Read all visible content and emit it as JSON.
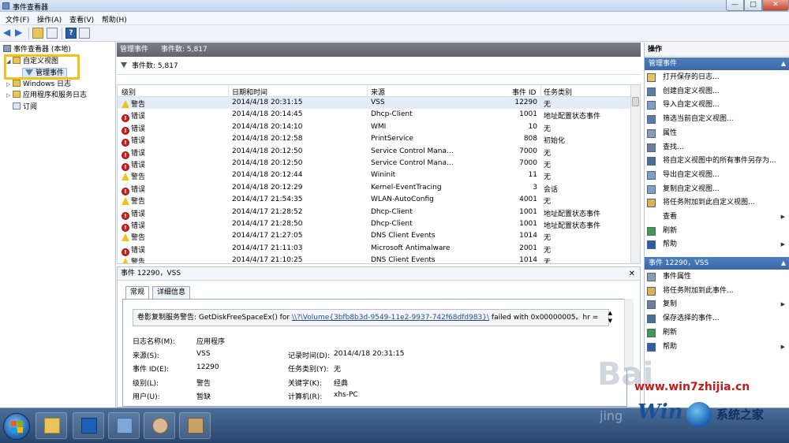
{
  "window": {
    "title": "事件查看器",
    "min_label": "—",
    "max_label": "□",
    "close_label": "✕"
  },
  "menu": [
    "文件(F)",
    "操作(A)",
    "查看(V)",
    "帮助(H)"
  ],
  "tree": {
    "root": "事件查看器 (本地)",
    "custom_views": "自定义视图",
    "admin_events": "管理事件",
    "windows_logs": "Windows 日志",
    "app_service_logs": "应用程序和服务日志",
    "subscriptions": "订阅"
  },
  "center": {
    "header_title": "管理事件",
    "header_count": "事件数: 5,817",
    "filter_text": "事件数: 5,817",
    "columns": [
      "级别",
      "日期和时间",
      "来源",
      "事件 ID",
      "任务类别"
    ],
    "rows": [
      {
        "level": "警告",
        "type": "warn",
        "datetime": "2014/4/18 20:31:15",
        "source": "VSS",
        "id": "12290",
        "category": "无"
      },
      {
        "level": "错误",
        "type": "err",
        "datetime": "2014/4/18 20:14:45",
        "source": "Dhcp-Client",
        "id": "1001",
        "category": "地址配置状态事件"
      },
      {
        "level": "错误",
        "type": "err",
        "datetime": "2014/4/18 20:14:10",
        "source": "WMI",
        "id": "10",
        "category": "无"
      },
      {
        "level": "错误",
        "type": "err",
        "datetime": "2014/4/18 20:12:58",
        "source": "PrintService",
        "id": "808",
        "category": "初始化"
      },
      {
        "level": "错误",
        "type": "err",
        "datetime": "2014/4/18 20:12:50",
        "source": "Service Control Mana...",
        "id": "7000",
        "category": "无"
      },
      {
        "level": "错误",
        "type": "err",
        "datetime": "2014/4/18 20:12:50",
        "source": "Service Control Mana...",
        "id": "7000",
        "category": "无"
      },
      {
        "level": "警告",
        "type": "warn",
        "datetime": "2014/4/18 20:12:44",
        "source": "Wininit",
        "id": "11",
        "category": "无"
      },
      {
        "level": "错误",
        "type": "err",
        "datetime": "2014/4/18 20:12:29",
        "source": "Kernel-EventTracing",
        "id": "3",
        "category": "会话"
      },
      {
        "level": "警告",
        "type": "warn",
        "datetime": "2014/4/17 21:54:35",
        "source": "WLAN-AutoConfig",
        "id": "4001",
        "category": "无"
      },
      {
        "level": "错误",
        "type": "err",
        "datetime": "2014/4/17 21:28:52",
        "source": "Dhcp-Client",
        "id": "1001",
        "category": "地址配置状态事件"
      },
      {
        "level": "错误",
        "type": "err",
        "datetime": "2014/4/17 21:28:50",
        "source": "Dhcp-Client",
        "id": "1001",
        "category": "地址配置状态事件"
      },
      {
        "level": "警告",
        "type": "warn",
        "datetime": "2014/4/17 21:27:05",
        "source": "DNS Client Events",
        "id": "1014",
        "category": "无"
      },
      {
        "level": "错误",
        "type": "err",
        "datetime": "2014/4/17 21:11:03",
        "source": "Microsoft Antimalware",
        "id": "2001",
        "category": "无"
      },
      {
        "level": "警告",
        "type": "warn",
        "datetime": "2014/4/17 21:10:25",
        "source": "DNS Client Events",
        "id": "1014",
        "category": "无"
      }
    ]
  },
  "detail": {
    "title": "事件 12290，VSS",
    "close": "✕",
    "tab_general": "常规",
    "tab_details": "详细信息",
    "desc_prefix": "卷影复制服务警告: GetDiskFreeSpaceEx() for ",
    "desc_link": "\\\\?\\Volume{3bfb8b3d-9549-11e2-9937-742f68dfd983}\\",
    "desc_suffix": " failed with 0x00000005。hr =",
    "log_name_label": "日志名称(M):",
    "log_name_value": "应用程序",
    "source_label": "来源(S):",
    "source_value": "VSS",
    "logged_label": "记录时间(D):",
    "logged_value": "2014/4/18 20:31:15",
    "event_id_label": "事件 ID(E):",
    "event_id_value": "12290",
    "task_label": "任务类别(Y):",
    "task_value": "无",
    "level_label": "级别(L):",
    "level_value": "警告",
    "keywords_label": "关键字(K):",
    "keywords_value": "经典",
    "user_label": "用户(U):",
    "user_value": "暂缺",
    "computer_label": "计算机(R):",
    "computer_value": "xhs-PC"
  },
  "actions": {
    "title": "操作",
    "section1": "管理事件",
    "section1_items": [
      "打开保存的日志...",
      "创建自定义视图...",
      "导入自定义视图...",
      "筛选当前自定义视图...",
      "属性",
      "查找...",
      "将自定义视图中的所有事件另存为...",
      "导出自定义视图...",
      "复制自定义视图...",
      "将任务附加到此自定义视图...",
      "查看",
      "刷新",
      "帮助"
    ],
    "section2": "事件 12290，VSS",
    "section2_items": [
      "事件属性",
      "将任务附加到此事件...",
      "复制",
      "保存选择的事件...",
      "刷新",
      "帮助"
    ]
  },
  "watermark": {
    "url": "www.win7zhijia.cn",
    "logo": "Win",
    "site": "系统之家",
    "baidu": "Bai",
    "jing": "jing"
  }
}
